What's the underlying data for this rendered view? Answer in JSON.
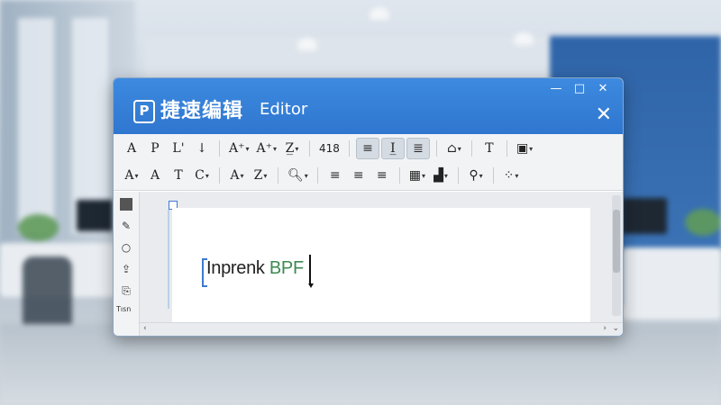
{
  "window": {
    "title_cn": "捷速编辑",
    "title_en": "Editor",
    "controls": {
      "minimize": "—",
      "maximize": "□",
      "close": "✕"
    },
    "close_big": "✕"
  },
  "toolbar": {
    "row1": [
      {
        "name": "font-a-button",
        "label": "A"
      },
      {
        "name": "font-p-button",
        "label": "P"
      },
      {
        "name": "italic-l-button",
        "label": "L'"
      },
      {
        "name": "arrow-down-button",
        "label": "↓"
      },
      {
        "name": "font-size-up-button",
        "label": "A⁺",
        "caret": true
      },
      {
        "name": "font-size-down-button",
        "label": "A⁺",
        "caret": true
      },
      {
        "name": "highlight-pen-button",
        "label": "Z̲",
        "caret": true
      },
      {
        "name": "line-spacing-button",
        "label": "418",
        "sans": true
      },
      {
        "name": "align-left-active-button",
        "label": "≡",
        "active": true
      },
      {
        "name": "align-center-active-button",
        "label": "I̲",
        "active": true
      },
      {
        "name": "align-justify-button",
        "label": "≣",
        "active": true
      },
      {
        "name": "fill-color-button",
        "label": "⌂",
        "caret": true
      },
      {
        "name": "clear-format-button",
        "label": "T"
      },
      {
        "name": "insert-box-button",
        "label": "▣",
        "caret": true
      }
    ],
    "row2": [
      {
        "name": "font-style-a-button",
        "label": "A",
        "caret": true
      },
      {
        "name": "font-style-a2-button",
        "label": "A"
      },
      {
        "name": "font-style-t-button",
        "label": "T"
      },
      {
        "name": "font-style-c-button",
        "label": "C",
        "caret": true
      },
      {
        "name": "font-color-button",
        "label": "A",
        "caret": true
      },
      {
        "name": "strike-pen-button",
        "label": "Z",
        "caret": true
      },
      {
        "name": "find-button",
        "label": "🔍︎",
        "caret": true
      },
      {
        "name": "align-left-button",
        "label": "≡"
      },
      {
        "name": "align-center-button",
        "label": "≡"
      },
      {
        "name": "align-right-button",
        "label": "≡"
      },
      {
        "name": "table-button",
        "label": "▦",
        "caret": true
      },
      {
        "name": "chart-button",
        "label": "▟",
        "caret": true
      },
      {
        "name": "shapes-button",
        "label": "⚲",
        "caret": true
      },
      {
        "name": "grid-button",
        "label": "⁘",
        "caret": true
      }
    ]
  },
  "sidebar": {
    "items": [
      "■",
      "✎",
      "○",
      "⇪",
      "⎘"
    ],
    "bottom_text": "Tısn"
  },
  "document": {
    "text_main": "Inprenk",
    "text_green": "BPF"
  },
  "scroll": {
    "left": "‹",
    "right": "›",
    "down": "⌄"
  }
}
